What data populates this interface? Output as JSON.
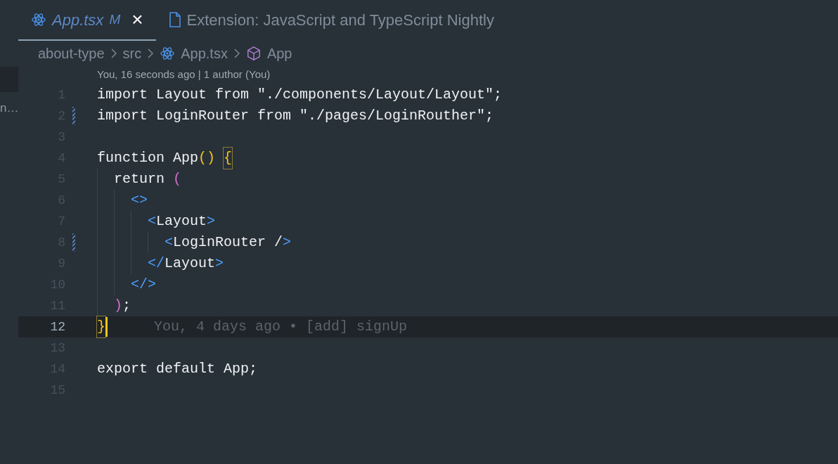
{
  "sidebar": {
    "items": [
      {
        "label": "n…",
        "selected": false
      }
    ]
  },
  "tabs": [
    {
      "label": "App.tsx",
      "badge": "M",
      "selected": true,
      "italic": true,
      "close": "×"
    },
    {
      "label": "Extension: JavaScript and TypeScript Nightly",
      "selected": false,
      "italic": false
    }
  ],
  "breadcrumb": [
    {
      "label": "about-type"
    },
    {
      "label": "src"
    },
    {
      "label": "App.tsx"
    },
    {
      "label": "App"
    }
  ],
  "codelens": "You, 16 seconds ago | 1 author (You)",
  "lines": [
    {
      "number": "1",
      "modified": false,
      "current": false,
      "tokens": [
        {
          "text": "import Layout from \"./components/Layout/Layout\";",
          "kind": "plain"
        }
      ]
    },
    {
      "number": "2",
      "modified": true,
      "current": false,
      "tokens": [
        {
          "text": "import LoginRouter from \"./pages/LoginRouther\";",
          "kind": "plain"
        }
      ]
    },
    {
      "number": "3",
      "modified": false,
      "current": false
    },
    {
      "number": "4",
      "modified": false,
      "current": false,
      "tokens": [
        {
          "text": "function App",
          "kind": "plain"
        },
        {
          "text": "()",
          "kind": "bracket-yellow"
        },
        {
          "text": " {",
          "kind": "brace-match"
        }
      ]
    },
    {
      "number": "5",
      "modified": false,
      "current": false,
      "tokens": [
        {
          "text": "  return ",
          "kind": "plain"
        },
        {
          "text": "(",
          "kind": "bracket-pink"
        }
      ]
    },
    {
      "number": "6",
      "modified": false,
      "current": false,
      "tokens": [
        {
          "text": "    <>",
          "kind": "tag"
        }
      ]
    },
    {
      "number": "7",
      "modified": false,
      "current": false,
      "tokens": [
        {
          "text": "      <",
          "kind": "tag"
        },
        {
          "text": "Layout",
          "kind": "plain"
        },
        {
          "text": ">",
          "kind": "tag"
        }
      ]
    },
    {
      "number": "8",
      "modified": true,
      "current": false,
      "tokens": [
        {
          "text": "        <",
          "kind": "tag"
        },
        {
          "text": "LoginRouter /",
          "kind": "plain"
        },
        {
          "text": ">",
          "kind": "tag"
        }
      ]
    },
    {
      "number": "9",
      "modified": false,
      "current": false,
      "tokens": [
        {
          "text": "      </",
          "kind": "tag"
        },
        {
          "text": "Layout",
          "kind": "plain"
        },
        {
          "text": ">",
          "kind": "tag"
        }
      ]
    },
    {
      "number": "10",
      "modified": false,
      "current": false,
      "tokens": [
        {
          "text": "    </>",
          "kind": "tag"
        }
      ]
    },
    {
      "number": "11",
      "modified": false,
      "current": false,
      "tokens": [
        {
          "text": "  )",
          "kind": "bracket-pink"
        },
        {
          "text": ";",
          "kind": "plain"
        }
      ]
    },
    {
      "number": "12",
      "modified": false,
      "current": true,
      "blame": "You, 4 days ago • [add] signUp",
      "tokens": [
        {
          "text": "}",
          "kind": "brace-match"
        }
      ]
    },
    {
      "number": "13",
      "modified": false,
      "current": false
    },
    {
      "number": "14",
      "modified": false,
      "current": false,
      "tokens": [
        {
          "text": "export default App;",
          "kind": "plain"
        }
      ]
    },
    {
      "number": "15",
      "modified": false,
      "current": false
    }
  ]
}
